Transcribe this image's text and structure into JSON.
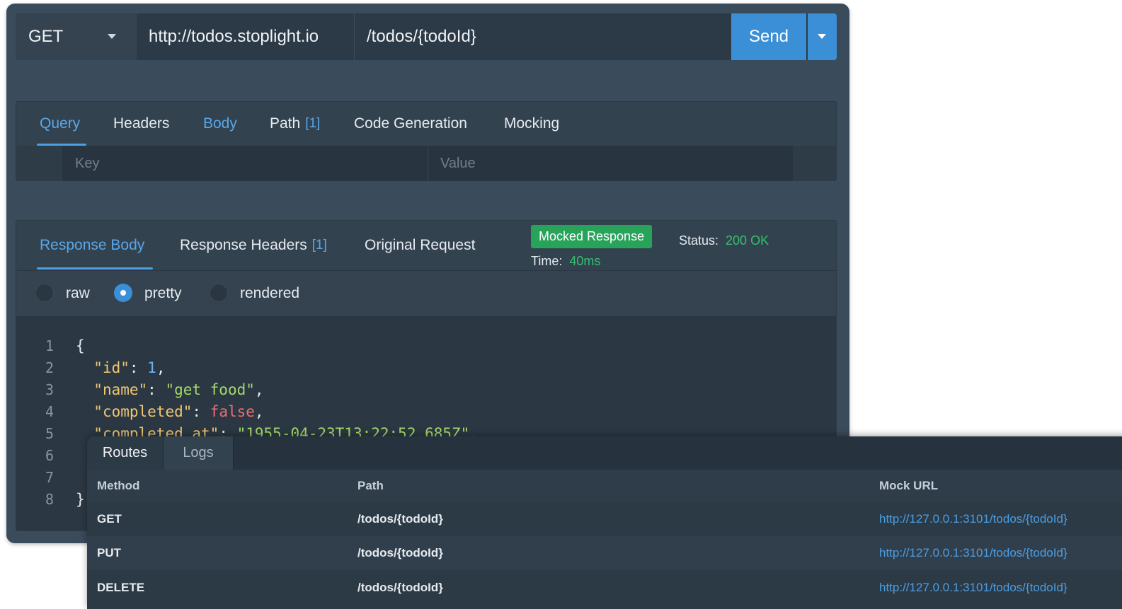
{
  "request": {
    "method": "GET",
    "host": "http://todos.stoplight.io",
    "path": "/todos/{todoId}",
    "send_label": "Send"
  },
  "request_tabs": [
    {
      "label": "Query",
      "active": true
    },
    {
      "label": "Headers"
    },
    {
      "label": "Body"
    },
    {
      "label": "Path",
      "count": "[1]"
    },
    {
      "label": "Code Generation"
    },
    {
      "label": "Mocking"
    }
  ],
  "query_params": {
    "key_placeholder": "Key",
    "value_placeholder": "Value"
  },
  "response_tabs": [
    {
      "label": "Response Body",
      "active": true
    },
    {
      "label": "Response Headers",
      "count": "[1]"
    },
    {
      "label": "Original Request"
    }
  ],
  "response_meta": {
    "badge": "Mocked Response",
    "status_label": "Status:",
    "status_value": "200 OK",
    "time_label": "Time:",
    "time_value": "40ms"
  },
  "view_modes": [
    {
      "label": "raw",
      "selected": false
    },
    {
      "label": "pretty",
      "selected": true
    },
    {
      "label": "rendered",
      "selected": false
    }
  ],
  "code_lines": [
    {
      "num": "1",
      "text": "{"
    },
    {
      "num": "2",
      "key": "\"id\"",
      "value": "1",
      "value_type": "number"
    },
    {
      "num": "3",
      "key": "\"name\"",
      "value": "\"get food\"",
      "value_type": "string"
    },
    {
      "num": "4",
      "key": "\"completed\"",
      "value": "false",
      "value_type": "boolean"
    },
    {
      "num": "5",
      "key": "\"completed_at\"",
      "value": "\"1955-04-23T13:22:52.685Z\"",
      "value_type": "string"
    },
    {
      "num": "6",
      "text": ""
    },
    {
      "num": "7",
      "text": ""
    },
    {
      "num": "8",
      "text": "}"
    }
  ],
  "routes_panel": {
    "tabs": [
      {
        "label": "Routes",
        "active": true
      },
      {
        "label": "Logs"
      }
    ],
    "columns": [
      "Method",
      "Path",
      "Mock URL"
    ],
    "rows": [
      {
        "method": "GET",
        "path": "/todos/{todoId}",
        "url": "http://127.0.0.1:3101/todos/{todoId}"
      },
      {
        "method": "PUT",
        "path": "/todos/{todoId}",
        "url": "http://127.0.0.1:3101/todos/{todoId}"
      },
      {
        "method": "DELETE",
        "path": "/todos/{todoId}",
        "url": "http://127.0.0.1:3101/todos/{todoId}"
      }
    ]
  },
  "colors": {
    "accent": "#3b8fd6",
    "tab_active": "#58a7e8",
    "success": "#27a35a",
    "panel": "#3a4b5c"
  }
}
